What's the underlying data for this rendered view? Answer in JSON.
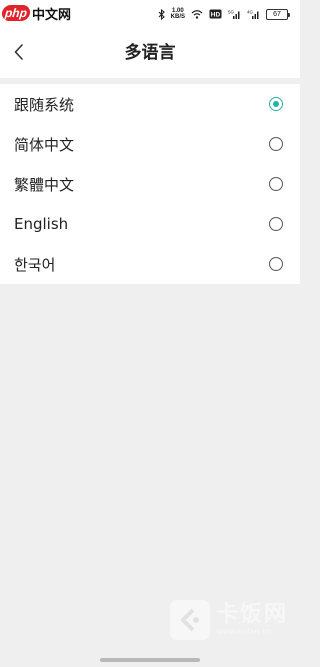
{
  "watermark_top": {
    "badge": "php",
    "text": "中文网"
  },
  "status_bar": {
    "icons": [
      "bluetooth-icon",
      "network-speed-icon",
      "wifi-icon",
      "hd-icon",
      "signal-icon",
      "signal-icon",
      "battery-icon"
    ],
    "network_speed_value": "1.00",
    "network_speed_unit": "KB/S",
    "hd_label": "HD",
    "battery_level": "67"
  },
  "header": {
    "back_icon": "chevron-left-icon",
    "title": "多语言"
  },
  "languages": {
    "selected_index": 0,
    "accent_color": "#24b3a8",
    "options": [
      {
        "label": "跟随系统",
        "selected": true
      },
      {
        "label": "简体中文",
        "selected": false
      },
      {
        "label": "繁體中文",
        "selected": false
      },
      {
        "label": "English",
        "selected": false
      },
      {
        "label": "한국어",
        "selected": false
      }
    ]
  },
  "watermark_bottom": {
    "icon": "kafan-logo-icon",
    "title": "卡饭网",
    "url": "www.kafan.cn"
  }
}
